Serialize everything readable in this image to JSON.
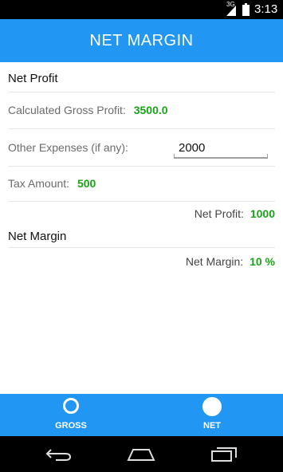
{
  "status_bar": {
    "network_type": "3G",
    "time": "3:13"
  },
  "app_bar": {
    "title": "NET MARGIN"
  },
  "net_profit_section": {
    "heading": "Net Profit",
    "gross_profit": {
      "label": "Calculated Gross Profit:",
      "value": "3500.0"
    },
    "other_expenses": {
      "label": "Other Expenses (if any):",
      "value": "2000"
    },
    "tax_amount": {
      "label": "Tax Amount:",
      "value": "500"
    },
    "net_profit": {
      "label": "Net Profit:",
      "value": "1000"
    }
  },
  "net_margin_section": {
    "heading": "Net Margin",
    "net_margin": {
      "label": "Net Margin:",
      "value": "10 %"
    }
  },
  "tabs": [
    {
      "label": "GROSS",
      "icon": "radio-unselected-icon",
      "selected": false
    },
    {
      "label": "NET",
      "icon": "radio-selected-icon",
      "selected": true
    }
  ],
  "nav_bar": {
    "buttons": [
      "back-icon",
      "home-icon",
      "recent-apps-icon"
    ]
  },
  "colors": {
    "primary": "#2196f3",
    "value_green": "#1aa31a",
    "label_gray": "#6b6b6b"
  }
}
